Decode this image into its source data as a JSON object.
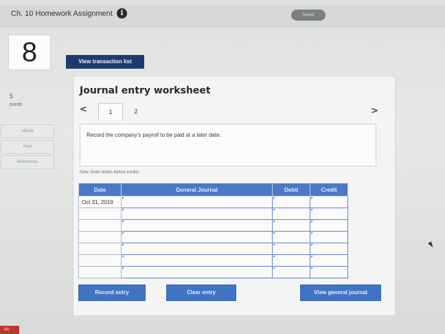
{
  "header": {
    "assignment_title": "Ch. 10 Homework Assignment",
    "info_icon": "i",
    "status_pill": "Saved"
  },
  "question": {
    "number": "8",
    "points_value": "5",
    "points_label": "points"
  },
  "sidebar": {
    "items": [
      {
        "label": "eBook"
      },
      {
        "label": "Print"
      },
      {
        "label": "References"
      }
    ]
  },
  "toolbar": {
    "view_transactions_label": "View transaction list"
  },
  "worksheet": {
    "title": "Journal entry worksheet",
    "prev_arrow": "<",
    "next_arrow": ">",
    "tabs": [
      {
        "label": "1",
        "active": true
      },
      {
        "label": "2",
        "active": false
      }
    ],
    "instruction": "Record the company's payroll to be paid at a later date.",
    "note": "Note: Enter debits before credits."
  },
  "journal": {
    "columns": [
      "Date",
      "General Journal",
      "Debit",
      "Credit"
    ],
    "rows": [
      {
        "date": "Oct 31, 2019",
        "account": "",
        "debit": "",
        "credit": ""
      },
      {
        "date": "",
        "account": "",
        "debit": "",
        "credit": ""
      },
      {
        "date": "",
        "account": "",
        "debit": "",
        "credit": ""
      },
      {
        "date": "",
        "account": "",
        "debit": "",
        "credit": ""
      },
      {
        "date": "",
        "account": "",
        "debit": "",
        "credit": ""
      },
      {
        "date": "",
        "account": "",
        "debit": "",
        "credit": ""
      },
      {
        "date": "",
        "account": "",
        "debit": "",
        "credit": ""
      }
    ]
  },
  "actions": {
    "record_label": "Record entry",
    "clear_label": "Clear entry",
    "view_journal_label": "View general journal"
  },
  "footer": {
    "brand_tag": "Mc"
  },
  "colors": {
    "header_blue": "#4d78c5",
    "button_blue": "#3f74c4",
    "nav_dark_blue": "#1f3b6e",
    "brand_red": "#c0352d"
  }
}
